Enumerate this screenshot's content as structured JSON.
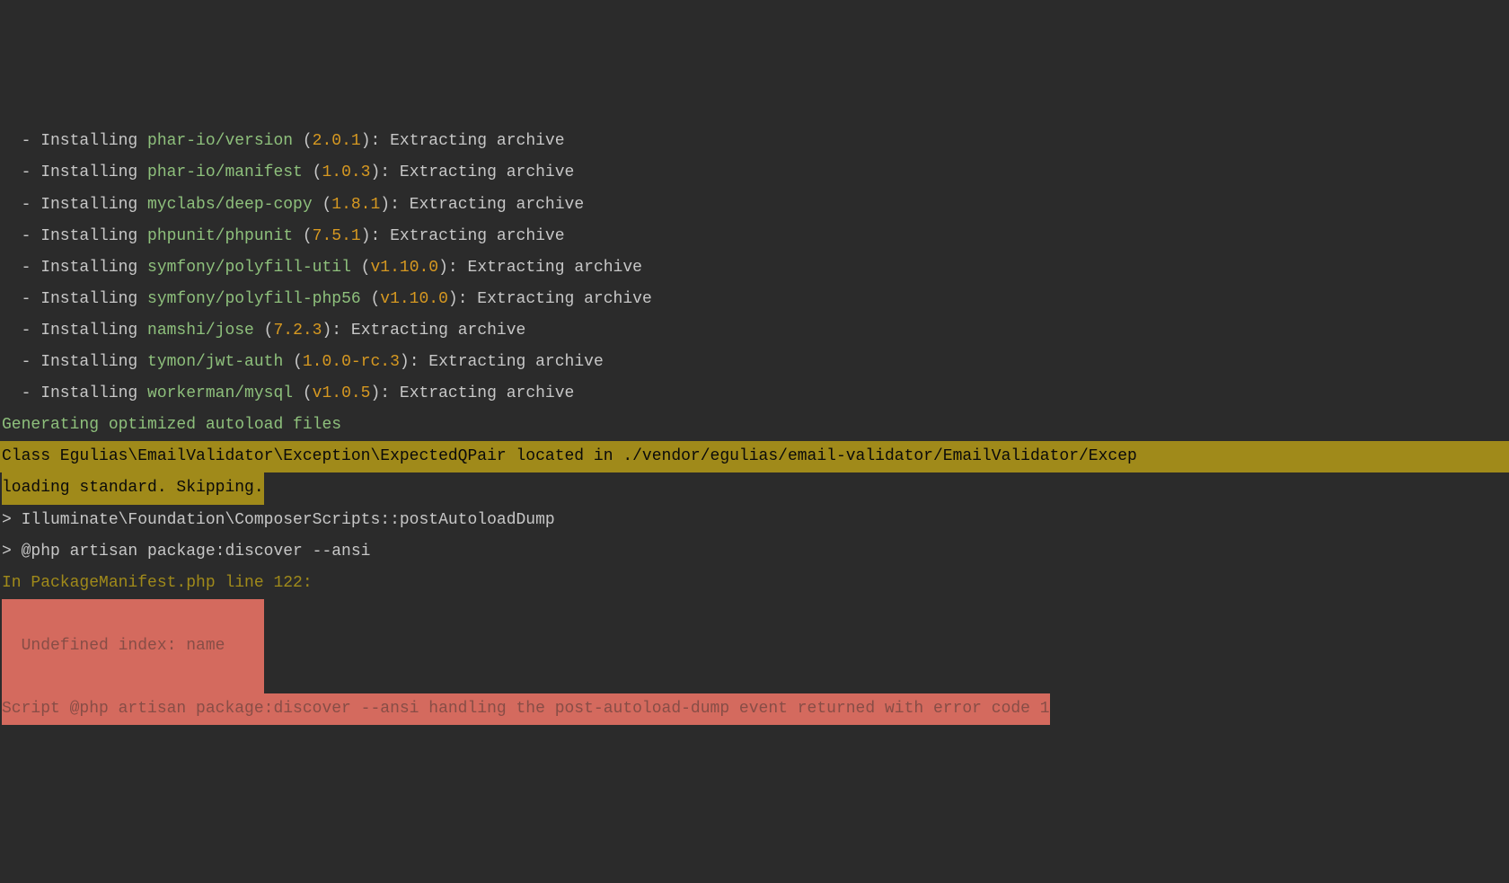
{
  "installs": [
    {
      "name": "phar-io/version",
      "version": "2.0.1",
      "action": "Extracting archive"
    },
    {
      "name": "phar-io/manifest",
      "version": "1.0.3",
      "action": "Extracting archive"
    },
    {
      "name": "myclabs/deep-copy",
      "version": "1.8.1",
      "action": "Extracting archive"
    },
    {
      "name": "phpunit/phpunit",
      "version": "7.5.1",
      "action": "Extracting archive"
    },
    {
      "name": "symfony/polyfill-util",
      "version": "v1.10.0",
      "action": "Extracting archive"
    },
    {
      "name": "symfony/polyfill-php56",
      "version": "v1.10.0",
      "action": "Extracting archive"
    },
    {
      "name": "namshi/jose",
      "version": "7.2.3",
      "action": "Extracting archive"
    },
    {
      "name": "tymon/jwt-auth",
      "version": "1.0.0-rc.3",
      "action": "Extracting archive"
    },
    {
      "name": "workerman/mysql",
      "version": "v1.0.5",
      "action": "Extracting archive"
    }
  ],
  "labels": {
    "bullet": "  - ",
    "installing": "Installing ",
    "lp": " (",
    "rp_colon": "): "
  },
  "generating": "Generating optimized autoload files",
  "psr4_warning_line1": "Class Egulias\\EmailValidator\\Exception\\ExpectedQPair located in ./vendor/egulias/email-validator/EmailValidator/Excep",
  "psr4_warning_line2": "loading standard. Skipping.",
  "script_lines": [
    "> Illuminate\\Foundation\\ComposerScripts::postAutoloadDump",
    "> @php artisan package:discover --ansi"
  ],
  "error_location": "In PackageManifest.php line 122:",
  "error_blocks": {
    "blank_pad": "                           ",
    "message": "  Undefined index: name    "
  },
  "final_error": "Script @php artisan package:discover --ansi handling the post-autoload-dump event returned with error code 1"
}
